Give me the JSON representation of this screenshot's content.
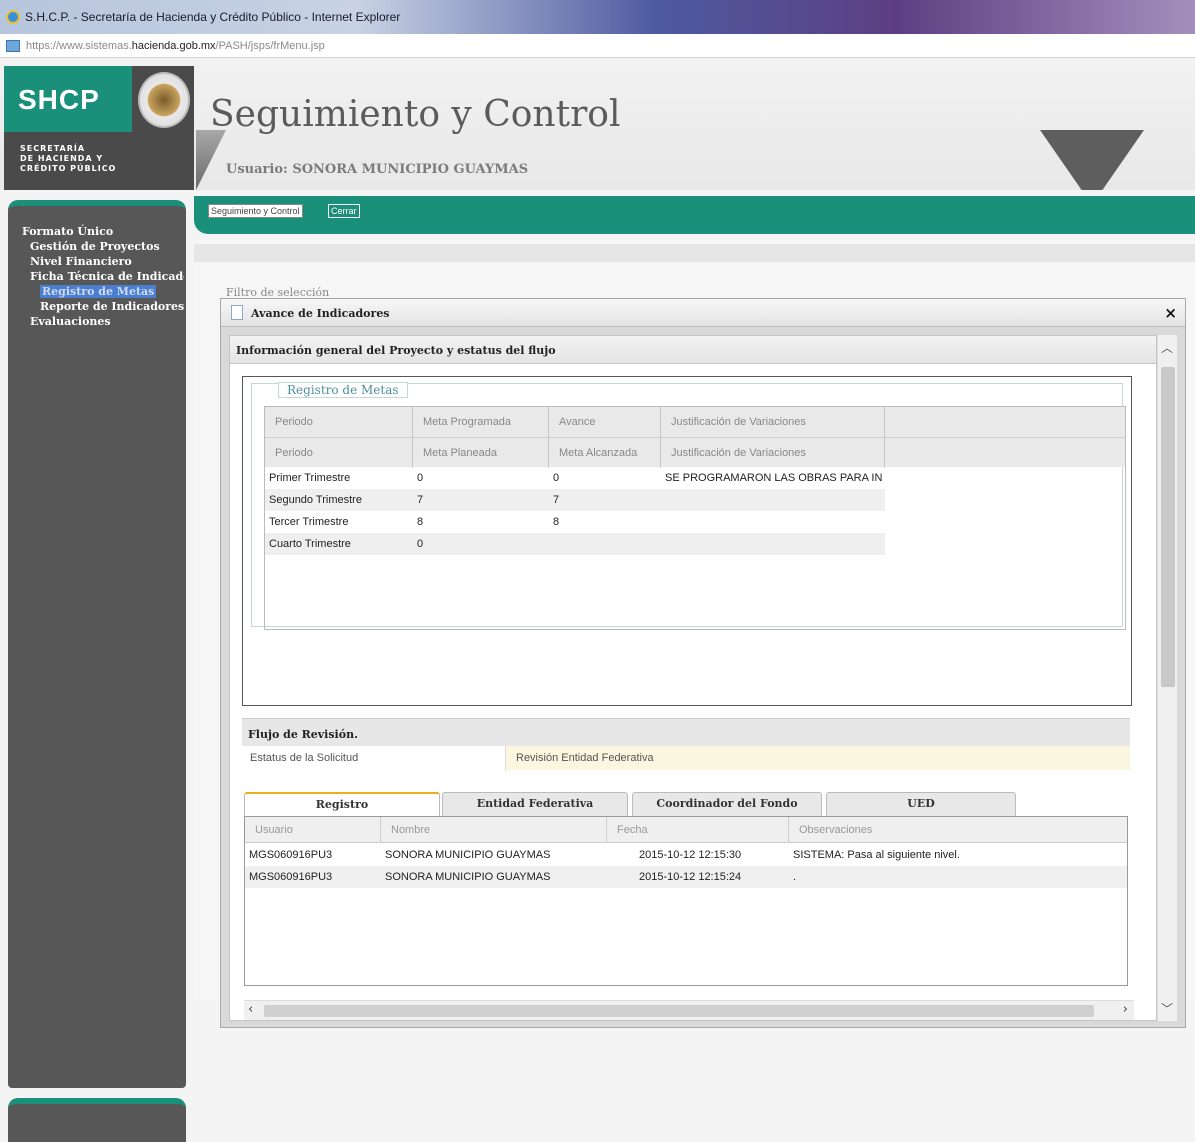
{
  "window": {
    "title": "S.H.C.P. - Secretaría de Hacienda y Crédito Público - Internet Explorer",
    "url_prefix": "https://www.sistemas.",
    "url_domain": "hacienda.gob.mx",
    "url_path": "/PASH/jsps/frMenu.jsp"
  },
  "header": {
    "logo": "SHCP",
    "logo_sub_1": "SECRETARÍA",
    "logo_sub_2": "DE HACIENDA Y",
    "logo_sub_3": "CRÉDITO PÚBLICO",
    "app_title": "Seguimiento y Control",
    "user_line": "Usuario: SONORA MUNICIPIO GUAYMAS"
  },
  "tabbar": {
    "tab1": "Seguimiento y Control",
    "tab2": "Cerrar"
  },
  "menu": {
    "root": "Formato Único",
    "items": [
      "Gestión de Proyectos",
      "Nivel Financiero",
      "Ficha Técnica de Indicadores"
    ],
    "sub_active": "Registro de Metas",
    "sub_2": "Reporte de Indicadores",
    "last": "Evaluaciones"
  },
  "background": {
    "filter_label": "Filtro de selección"
  },
  "modal": {
    "title": "Avance de Indicadores",
    "close": "×",
    "info_title": "Información general del Proyecto y estatus del flujo",
    "metas": {
      "legend": "Registro de Metas",
      "header1": [
        "Periodo",
        "Meta Programada",
        "Avance",
        "Justificación de Variaciones"
      ],
      "header2": [
        "Periodo",
        "Meta Planeada",
        "Meta Alcanzada",
        "Justificación de Variaciones"
      ],
      "rows": [
        [
          "Primer Trimestre",
          "0",
          "0",
          "SE PROGRAMARON LAS OBRAS PARA IN"
        ],
        [
          "Segundo Trimestre",
          "7",
          "7",
          ""
        ],
        [
          "Tercer Trimestre",
          "8",
          "8",
          ""
        ],
        [
          "Cuarto Trimestre",
          "0",
          "",
          ""
        ]
      ]
    },
    "flujo": {
      "title": "Flujo de Revisión.",
      "estatus_label": "Estatus de la Solicitud",
      "estatus_value": "Revisión Entidad Federativa",
      "tabs": [
        "Registro",
        "Entidad Federativa",
        "Coordinador del Fondo",
        "UED"
      ],
      "columns": [
        "Usuario",
        "Nombre",
        "Fecha",
        "Observaciones"
      ],
      "rows": [
        [
          "MGS060916PU3",
          "SONORA MUNICIPIO GUAYMAS",
          "2015-10-12 12:15:30",
          "SISTEMA: Pasa al siguiente nivel."
        ],
        [
          "MGS060916PU3",
          "SONORA MUNICIPIO GUAYMAS",
          "2015-10-12 12:15:24",
          "."
        ]
      ]
    }
  },
  "colors": {
    "brand_teal": "#1a8f7a",
    "sidebar_gray": "#575757",
    "highlight": "#fbf6e0"
  }
}
